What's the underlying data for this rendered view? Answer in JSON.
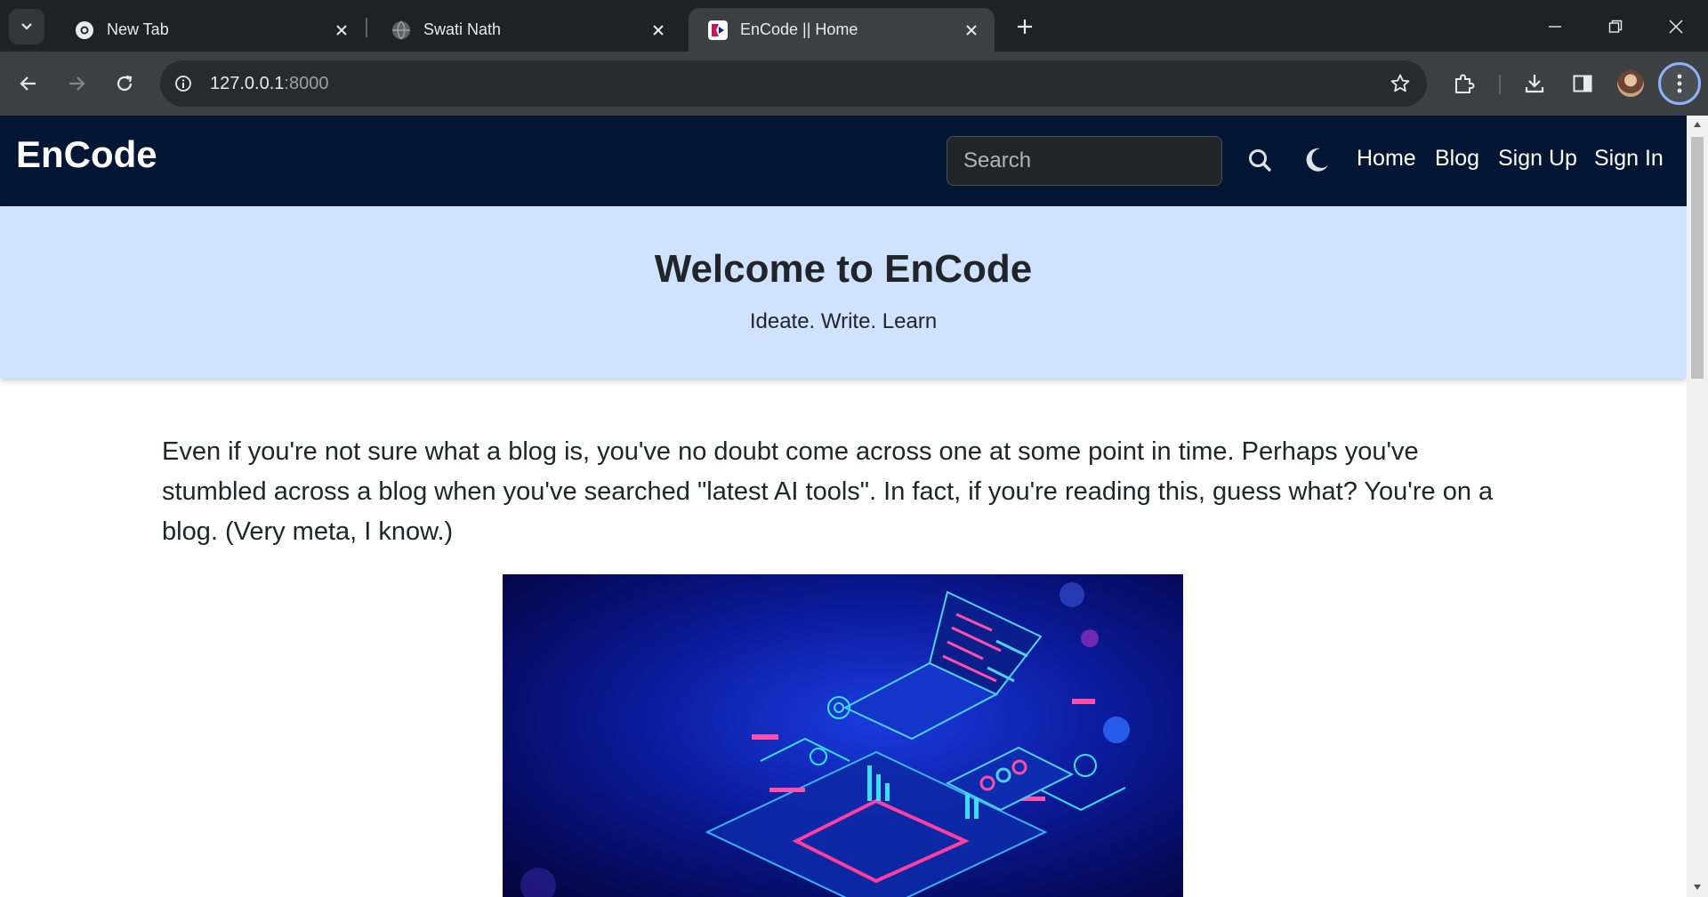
{
  "browser": {
    "tabs": [
      {
        "title": "New Tab",
        "icon": "chrome-icon",
        "active": false
      },
      {
        "title": "Swati Nath",
        "icon": "globe-icon",
        "active": false
      },
      {
        "title": "EnCode || Home",
        "icon": "encode-favicon-icon",
        "active": true
      }
    ],
    "url_host": "127.0.0.1",
    "url_port": ":8000"
  },
  "site": {
    "brand": "EnCode",
    "search_placeholder": "Search",
    "nav": {
      "home": "Home",
      "blog": "Blog",
      "signup": "Sign Up",
      "signin": "Sign In"
    },
    "hero": {
      "title": "Welcome to EnCode",
      "subtitle": "Ideate. Write. Learn"
    },
    "intro": "Even if you're not sure what a blog is, you've no doubt come across one at some point in time. Perhaps you've stumbled across a blog when you've searched \"latest AI tools\". In fact, if you're reading this, guess what? You're on a blog. (Very meta, I know.)"
  },
  "colors": {
    "navbar": "#031633",
    "hero_bg": "#cfe2ff",
    "chrome_dark": "#202124",
    "chrome_toolbar": "#3c4043"
  }
}
